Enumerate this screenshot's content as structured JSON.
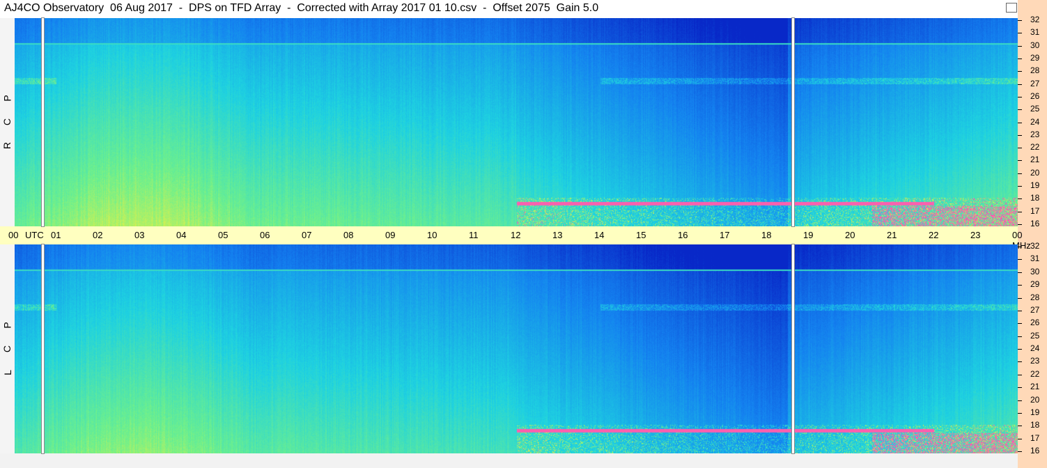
{
  "window": {
    "title": "AJ4CO Observatory  06 Aug 2017  -  DPS on TFD Array  -  Corrected with Array 2017 01 10.csv  -  Offset 2075  Gain 5.0"
  },
  "panels": {
    "top": {
      "label_letters": [
        "R",
        "C",
        "P"
      ]
    },
    "bottom": {
      "label_letters": [
        "L",
        "C",
        "P"
      ]
    }
  },
  "time_axis": {
    "ticks": [
      "00",
      "UTC",
      "01",
      "02",
      "03",
      "04",
      "05",
      "06",
      "07",
      "08",
      "09",
      "10",
      "11",
      "12",
      "13",
      "14",
      "15",
      "16",
      "17",
      "18",
      "19",
      "20",
      "21",
      "22",
      "23",
      "00 MHz"
    ]
  },
  "freq_axis": {
    "ticks": [
      "32",
      "31",
      "30",
      "29",
      "28",
      "27",
      "26",
      "25",
      "24",
      "23",
      "22",
      "21",
      "20",
      "19",
      "18",
      "17",
      "16"
    ]
  },
  "colors": {
    "background_blue": "#1a8cf0",
    "deep_blue": "#0a3cc8",
    "cyan": "#20d8e0",
    "green": "#80f080",
    "yellow": "#f0f040",
    "magenta": "#ff30d0",
    "axis_band": "#ffffc0",
    "freq_band": "#ffd9b8"
  }
}
